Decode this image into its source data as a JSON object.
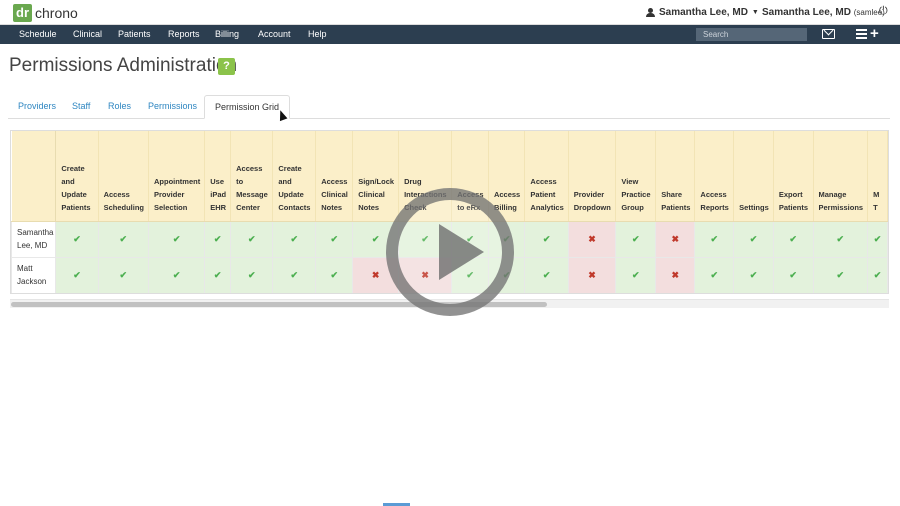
{
  "header": {
    "logo_prefix": "dr",
    "logo_name": "chrono",
    "user_name": "Samantha Lee, MD",
    "practice_name": "Samantha Lee, MD",
    "practice_username": "(samlee)"
  },
  "nav": {
    "items": [
      "Schedule",
      "Clinical",
      "Patients",
      "Reports",
      "Billing",
      "Account",
      "Help"
    ],
    "search_placeholder": "Search"
  },
  "page": {
    "title": "Permissions Administration",
    "help_label": "?"
  },
  "tabs": [
    {
      "label": "Providers",
      "active": false
    },
    {
      "label": "Staff",
      "active": false
    },
    {
      "label": "Roles",
      "active": false
    },
    {
      "label": "Permissions",
      "active": false
    },
    {
      "label": "Permission Grid",
      "active": true
    }
  ],
  "grid": {
    "columns": [
      [
        "Create",
        "and",
        "Update",
        "Patients"
      ],
      [
        "Access",
        "Scheduling"
      ],
      [
        "Appointment",
        "Provider",
        "Selection"
      ],
      [
        "Use",
        "iPad",
        "EHR"
      ],
      [
        "Access",
        "to",
        "Message",
        "Center"
      ],
      [
        "Create",
        "and",
        "Update",
        "Contacts"
      ],
      [
        "Access",
        "Clinical",
        "Notes"
      ],
      [
        "Sign/Lock",
        "Clinical",
        "Notes"
      ],
      [
        "Drug",
        "Interactions",
        "Check"
      ],
      [
        "Access",
        "to eRx"
      ],
      [
        "Access",
        "Billing"
      ],
      [
        "Access",
        "Patient",
        "Analytics"
      ],
      [
        "Provider",
        "Dropdown"
      ],
      [
        "View",
        "Practice",
        "Group"
      ],
      [
        "Share",
        "Patients"
      ],
      [
        "Access",
        "Reports"
      ],
      [
        "Settings"
      ],
      [
        "Export",
        "Patients"
      ],
      [
        "Manage",
        "Permissions"
      ],
      [
        "M",
        "T"
      ]
    ],
    "rows": [
      {
        "name": [
          "Samantha",
          "Lee, MD"
        ],
        "values": [
          true,
          true,
          true,
          true,
          true,
          true,
          true,
          true,
          true,
          true,
          true,
          true,
          false,
          true,
          false,
          true,
          true,
          true,
          true,
          true
        ]
      },
      {
        "name": [
          "Matt",
          "Jackson"
        ],
        "values": [
          true,
          true,
          true,
          true,
          true,
          true,
          true,
          false,
          false,
          true,
          true,
          true,
          false,
          true,
          false,
          true,
          true,
          true,
          true,
          true
        ]
      }
    ],
    "check_glyph": "✔",
    "cross_glyph": "✖"
  },
  "colors": {
    "navbar": "#2c3e50",
    "header_cell": "#fbefc9",
    "allowed_cell": "#e3f2dc",
    "denied_cell": "#f3dede",
    "brand_green": "#6aa84f"
  },
  "video": {
    "overlay_icon": "play-icon"
  }
}
